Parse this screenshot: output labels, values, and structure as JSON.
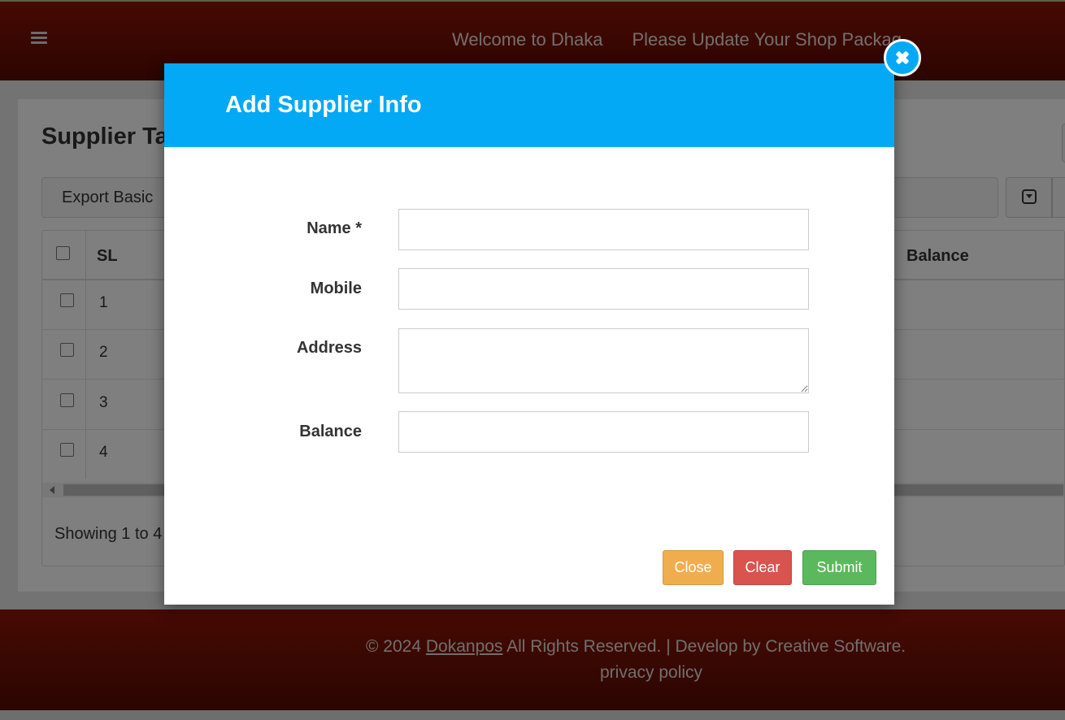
{
  "header": {
    "marquee": [
      "Welcome to Dhaka",
      "Please Update Your Shop Packag"
    ]
  },
  "page": {
    "title": "Supplier Ta",
    "export_label": "Export Basic",
    "table": {
      "columns": [
        "SL",
        "Balance"
      ],
      "rows": [
        "1",
        "2",
        "3",
        "4"
      ]
    },
    "showing_text": "Showing 1 to 4"
  },
  "modal": {
    "title": "Add Supplier Info",
    "fields": {
      "name_label": "Name *",
      "mobile_label": "Mobile",
      "address_label": "Address",
      "balance_label": "Balance"
    },
    "buttons": {
      "close": "Close",
      "clear": "Clear",
      "submit": "Submit"
    }
  },
  "footer": {
    "copyright": "© 2024",
    "brand_link": "Dokanpos",
    "rights": "All Rights Reserved. | Develop by  Creative Software.",
    "privacy": "privacy policy"
  },
  "colors": {
    "header_bg": "#7a1005",
    "modal_header": "#03a9f4",
    "close_btn": "#f0ad4e",
    "clear_btn": "#d9534f",
    "submit_btn": "#5cb85c"
  }
}
